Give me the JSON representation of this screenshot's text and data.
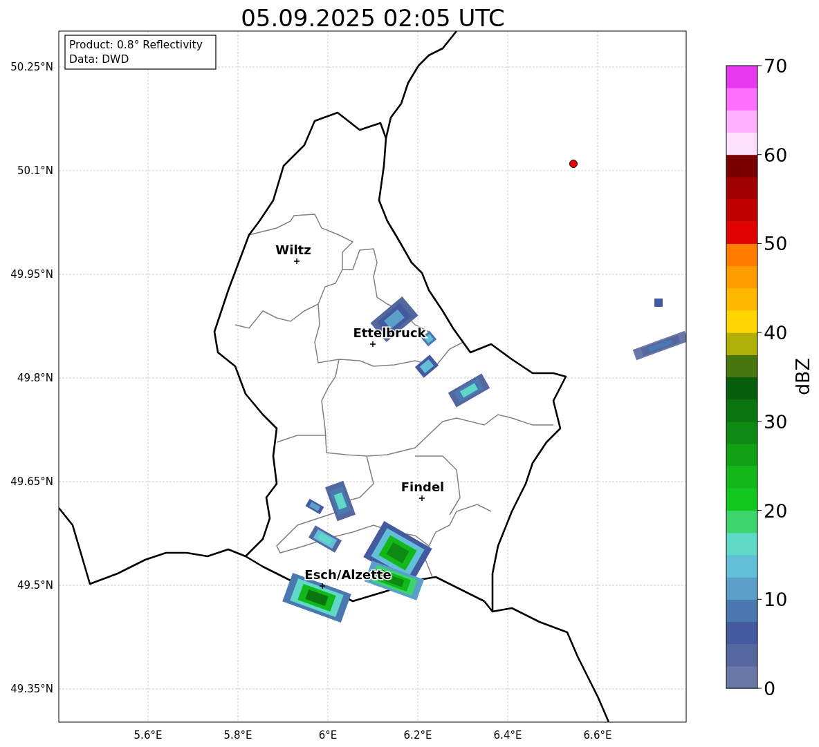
{
  "title": "05.09.2025 02:05 UTC",
  "info_box": {
    "product": "Product: 0.8° Reflectivity",
    "data": "Data: DWD"
  },
  "lat_ticks": [
    "50.25°N",
    "50.1°N",
    "49.95°N",
    "49.8°N",
    "49.65°N",
    "49.5°N",
    "49.35°N"
  ],
  "lon_ticks": [
    "5.6°E",
    "5.8°E",
    "6°E",
    "6.2°E",
    "6.4°E",
    "6.6°E"
  ],
  "cities": [
    {
      "name": "Wiltz"
    },
    {
      "name": "Ettelbruck"
    },
    {
      "name": "Findel"
    },
    {
      "name": "Esch/Alzette"
    }
  ],
  "colorbar": {
    "label": "dBZ",
    "ticks": [
      "70",
      "60",
      "50",
      "40",
      "30",
      "20",
      "10",
      "0"
    ],
    "bands": [
      {
        "color": "#6a78a8"
      },
      {
        "color": "#55679f"
      },
      {
        "color": "#435a9f"
      },
      {
        "color": "#4a78b0"
      },
      {
        "color": "#5a9fc8"
      },
      {
        "color": "#62bfd8"
      },
      {
        "color": "#60d8c8"
      },
      {
        "color": "#3cd46c"
      },
      {
        "color": "#12c81e"
      },
      {
        "color": "#12b81a"
      },
      {
        "color": "#10a014"
      },
      {
        "color": "#0e8a12"
      },
      {
        "color": "#0a7410"
      },
      {
        "color": "#065e0c"
      },
      {
        "color": "#48760e"
      },
      {
        "color": "#b0b008"
      },
      {
        "color": "#ffd600"
      },
      {
        "color": "#ffb800"
      },
      {
        "color": "#ff9c00"
      },
      {
        "color": "#ff7c00"
      },
      {
        "color": "#e00000"
      },
      {
        "color": "#c00000"
      },
      {
        "color": "#a00000"
      },
      {
        "color": "#780000"
      },
      {
        "color": "#ffe0ff"
      },
      {
        "color": "#ffb0ff"
      },
      {
        "color": "#ff70ff"
      },
      {
        "color": "#e838f0"
      }
    ]
  }
}
